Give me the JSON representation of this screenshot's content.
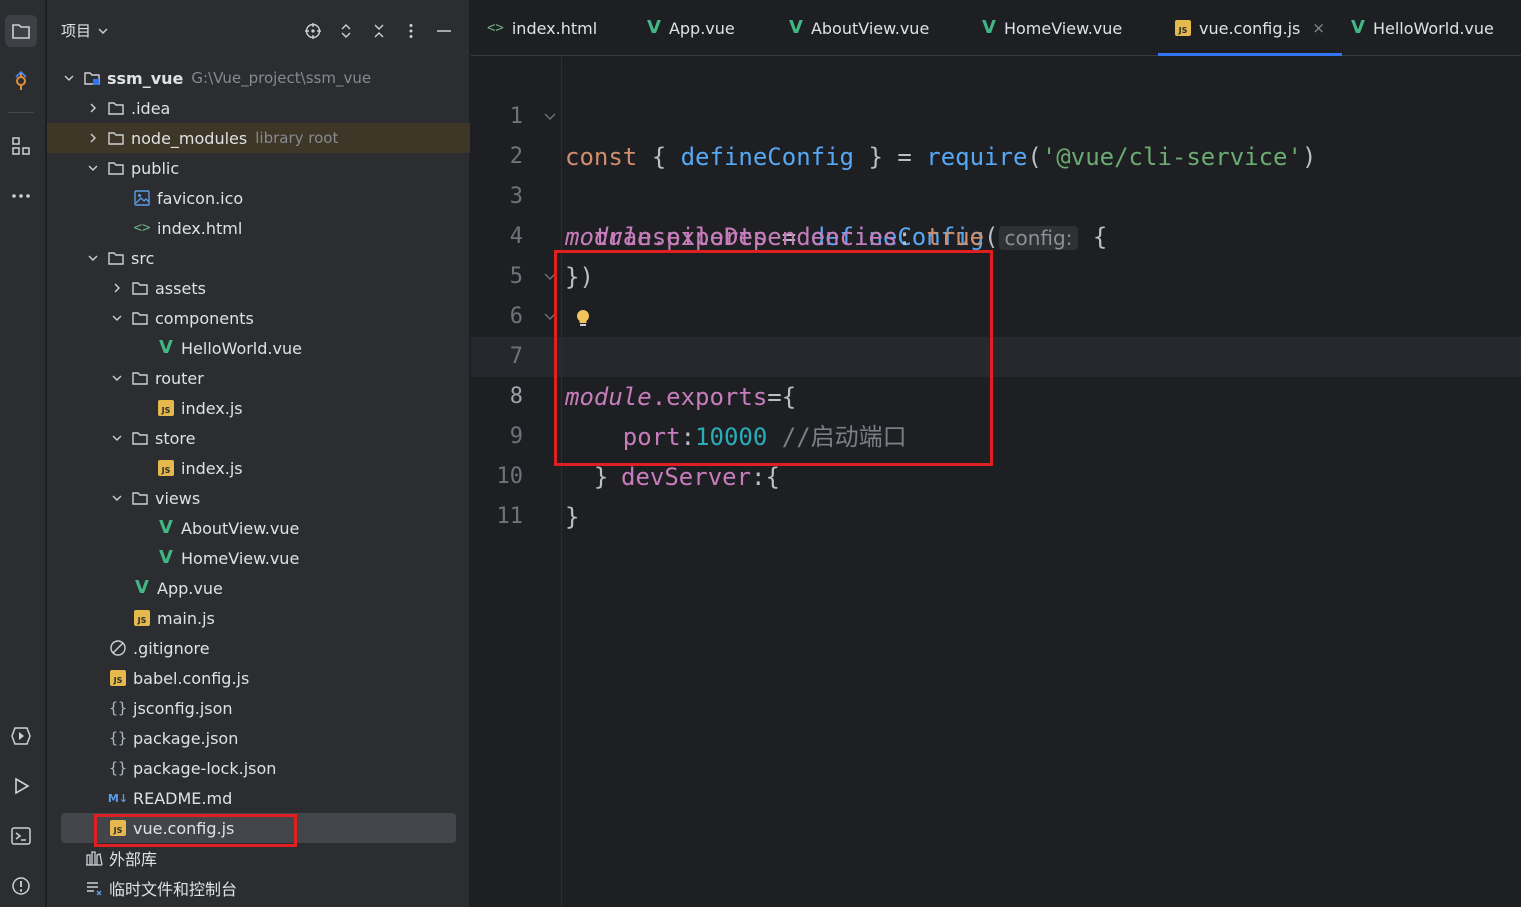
{
  "project_panel": {
    "title": "项目",
    "tree": [
      {
        "name": "ssm_vue",
        "hint": "G:\\Vue_project\\ssm_vue"
      },
      {
        "name": ".idea"
      },
      {
        "name": "node_modules",
        "hint": "library root"
      },
      {
        "name": "public"
      },
      {
        "name": "favicon.ico"
      },
      {
        "name": "index.html"
      },
      {
        "name": "src"
      },
      {
        "name": "assets"
      },
      {
        "name": "components"
      },
      {
        "name": "HelloWorld.vue"
      },
      {
        "name": "router"
      },
      {
        "name": "index.js"
      },
      {
        "name": "store"
      },
      {
        "name": "index.js"
      },
      {
        "name": "views"
      },
      {
        "name": "AboutView.vue"
      },
      {
        "name": "HomeView.vue"
      },
      {
        "name": "App.vue"
      },
      {
        "name": "main.js"
      },
      {
        "name": ".gitignore"
      },
      {
        "name": "babel.config.js"
      },
      {
        "name": "jsconfig.json"
      },
      {
        "name": "package.json"
      },
      {
        "name": "package-lock.json"
      },
      {
        "name": "README.md"
      },
      {
        "name": "vue.config.js"
      },
      {
        "name": "外部库"
      },
      {
        "name": "临时文件和控制台"
      }
    ]
  },
  "tabs": [
    {
      "label": "index.html"
    },
    {
      "label": "App.vue"
    },
    {
      "label": "AboutView.vue"
    },
    {
      "label": "HomeView.vue"
    },
    {
      "label": "vue.config.js",
      "close": "×"
    },
    {
      "label": "HelloWorld.vue"
    }
  ],
  "editor": {
    "line_numbers": [
      "1",
      "2",
      "3",
      "4",
      "5",
      "6",
      "7",
      "8",
      "9",
      "10",
      "11"
    ],
    "tokens": {
      "l1": [
        "const",
        " { ",
        "defineConfig",
        " } = ",
        "require",
        "(",
        "'@vue/cli-service'",
        ")"
      ],
      "l2": [
        "module",
        ".exports",
        " = ",
        "defineConfig",
        "(",
        "config:",
        " {"
      ],
      "l3": [
        "  ",
        "transpileDependencies",
        ": ",
        "true"
      ],
      "l4": [
        "})"
      ],
      "l6": [
        "module",
        ".exports",
        "={"
      ],
      "l7": [
        "  ",
        "devServer",
        ":{"
      ],
      "l8": [
        "    ",
        "port",
        ":",
        "10000",
        " ",
        "//启动端口"
      ],
      "l9": [
        "  }"
      ],
      "l10": [
        "}"
      ]
    }
  },
  "colors": {
    "accent": "#3574f0",
    "highlight_box": "#e02020",
    "background": "#1e1f22",
    "panel": "#2b2d30"
  }
}
